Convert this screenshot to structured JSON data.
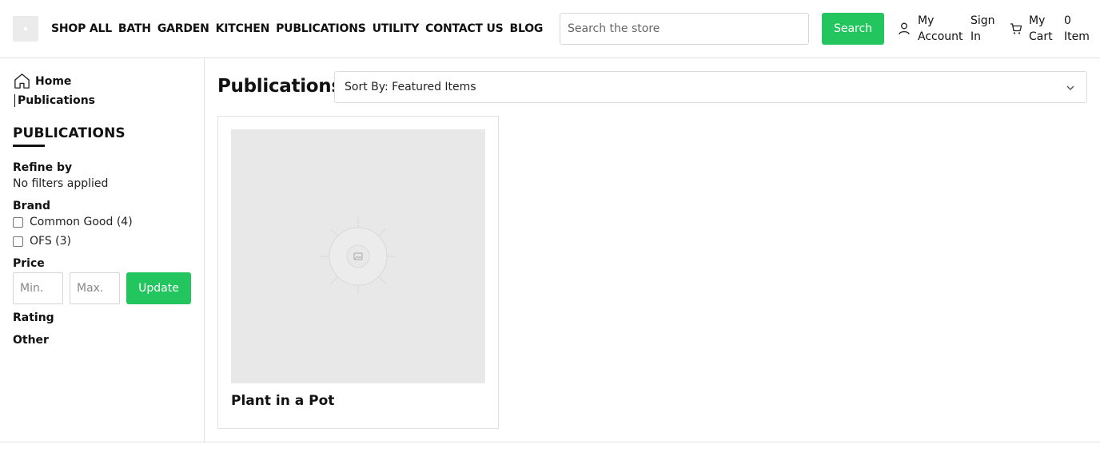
{
  "header": {
    "nav": [
      "SHOP ALL",
      "BATH",
      "GARDEN",
      "KITCHEN",
      "PUBLICATIONS",
      "UTILITY",
      "CONTACT US",
      "BLOG"
    ],
    "search": {
      "placeholder": "Search the store",
      "button_label": "Search"
    },
    "account": {
      "line1": "My",
      "line2": "Account"
    },
    "signin": {
      "line1": "Sign",
      "line2": "In"
    },
    "cart": {
      "line1": "My",
      "line2": "Cart"
    },
    "cart_count": {
      "line1": "0",
      "line2": "Item"
    },
    "icons": {
      "account": "user-icon",
      "cart": "cart-icon"
    }
  },
  "breadcrumb": {
    "home": "Home",
    "current": "Publications",
    "home_icon": "home-icon"
  },
  "sidebar": {
    "title": "PUBLICATIONS",
    "refine_label": "Refine by",
    "refine_status": "No filters applied",
    "brand_label": "Brand",
    "brands": [
      "Common Good (4)",
      "OFS (3)"
    ],
    "price_label": "Price",
    "price_min_placeholder": "Min.",
    "price_max_placeholder": "Max.",
    "update_label": "Update",
    "rating_label": "Rating",
    "other_label": "Other"
  },
  "main": {
    "title": "Publications",
    "sort_label": "Sort By: Featured Items",
    "sort_icon": "chevron-down-icon",
    "products": [
      {
        "name": "Plant in a Pot",
        "image_icon": "image-placeholder-icon"
      }
    ]
  },
  "colors": {
    "accent": "#22c55e",
    "placeholder_bg": "#e8e8e8",
    "border": "#e2e2e2"
  }
}
